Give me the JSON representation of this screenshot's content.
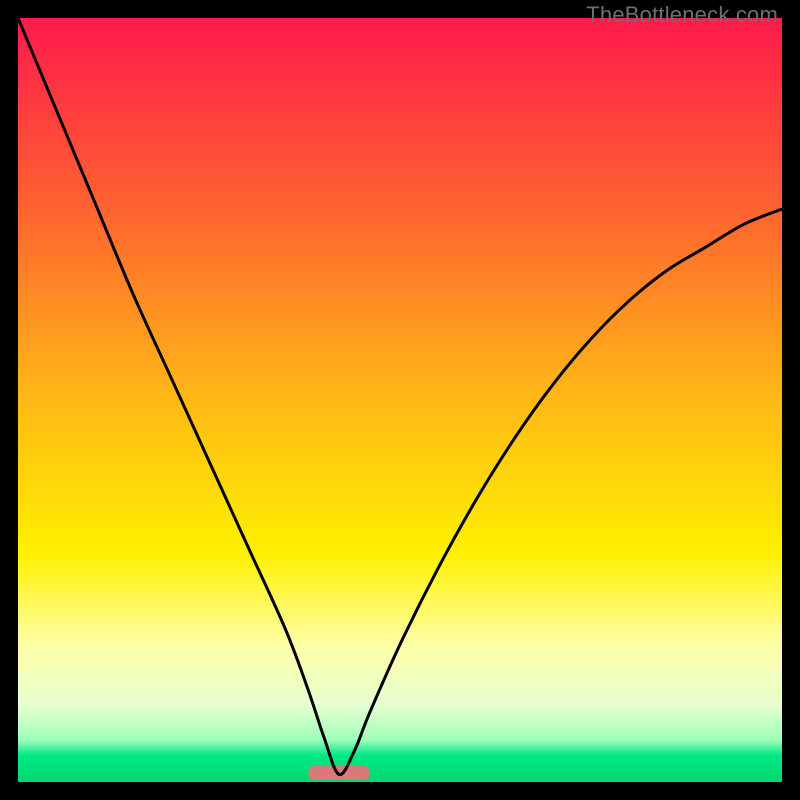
{
  "watermark": "TheBottleneck.com",
  "chart_data": {
    "type": "line",
    "title": "",
    "xlabel": "",
    "ylabel": "",
    "xlim": [
      0,
      100
    ],
    "ylim": [
      0,
      100
    ],
    "background_gradient": {
      "stops": [
        {
          "pos": 0.0,
          "color": "#ff1a4b"
        },
        {
          "pos": 0.25,
          "color": "#ff6330"
        },
        {
          "pos": 0.5,
          "color": "#ffb915"
        },
        {
          "pos": 0.7,
          "color": "#fff000"
        },
        {
          "pos": 0.82,
          "color": "#feffa6"
        },
        {
          "pos": 0.9,
          "color": "#e6ffcf"
        },
        {
          "pos": 0.945,
          "color": "#9dffba"
        },
        {
          "pos": 0.965,
          "color": "#00e884"
        },
        {
          "pos": 1.0,
          "color": "#00d770"
        }
      ]
    },
    "minimum_marker": {
      "x": 42,
      "width": 8,
      "color": "#d87a7a"
    },
    "series": [
      {
        "name": "bottleneck-curve",
        "x": [
          0,
          5,
          10,
          15,
          20,
          25,
          30,
          35,
          38,
          40,
          42,
          44,
          46,
          50,
          55,
          60,
          65,
          70,
          75,
          80,
          85,
          90,
          95,
          100
        ],
        "y": [
          100,
          88,
          76,
          64,
          53,
          42,
          31,
          20,
          12,
          6,
          1,
          4,
          9,
          18,
          28,
          37,
          45,
          52,
          58,
          63,
          67,
          70,
          73,
          75
        ]
      }
    ]
  }
}
